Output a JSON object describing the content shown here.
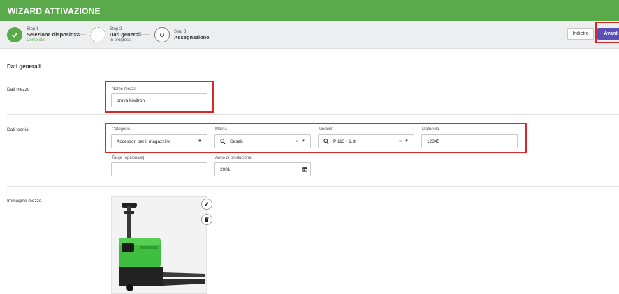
{
  "window": {
    "title": "WIZARD ATTIVAZIONE"
  },
  "steps": [
    {
      "small": "Step 1",
      "title": "Seleziona dispositivo",
      "sub": "Completo",
      "state": "done"
    },
    {
      "small": "Step 2",
      "title": "Dati generali",
      "sub": "In progress",
      "state": "active"
    },
    {
      "small": "Step 3",
      "title": "Assegnazione",
      "sub": "",
      "state": "todo"
    }
  ],
  "actions": {
    "back_label": "Indietro",
    "next_label": "Avanti"
  },
  "section": {
    "title": "Dati generali"
  },
  "dati_mezzo": {
    "row_label": "Dati mezzo",
    "nome_label": "Nome mezzo",
    "nome_value": "prova kiwitron"
  },
  "dati_tecnici": {
    "row_label": "Dati tecnici",
    "categoria_label": "Categoria",
    "categoria_value": "Accessori per il magazzino",
    "marca_label": "Marca",
    "marca_value": "Cesab",
    "modello_label": "Modello",
    "modello_value": "P 113 - 1.3t",
    "matricola_label": "Matricola",
    "matricola_value": "12345",
    "targa_label": "Targa (opzionale)",
    "targa_value": "",
    "anno_label": "Anno di produzione",
    "anno_value": "2001"
  },
  "immagine": {
    "row_label": "Immagine mezzo"
  },
  "colors": {
    "header_green": "#5aa94b",
    "primary_purple": "#5b4fb8",
    "highlight_red": "#d62828",
    "forklift_green": "#3fbf3f"
  },
  "icons": [
    "check-icon",
    "spinner-icon",
    "circle-icon",
    "search-icon",
    "clear-icon",
    "chevron-down-icon",
    "calendar-icon",
    "pencil-icon",
    "trash-icon"
  ]
}
